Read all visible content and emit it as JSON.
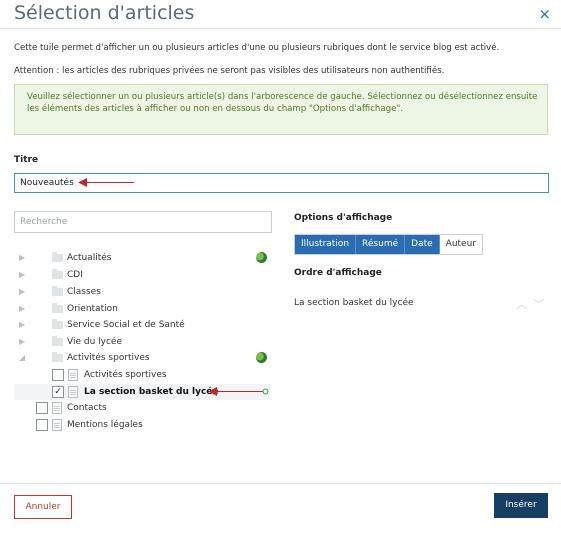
{
  "dialog": {
    "title": "Sélection d'articles",
    "close_label": "×",
    "intro_line_1": "Cette tuile permet d'afficher un ou plusieurs articles d'une ou plusieurs rubriques dont le service blog est activé.",
    "intro_line_2": "Attention : les articles des rubriques privées ne seront pas visibles des utilisateurs non authentifiés.",
    "info_line_1": "Veuillez sélectionner un ou plusieurs article(s) dans l'arborescence de gauche. Sélectionnez ou désélectionnez ensuite",
    "info_line_2": "les éléments des articles à afficher ou non en dessous du champ \"Options d'affichage\"."
  },
  "form": {
    "titre_label": "Titre",
    "titre_value": "Nouveautés"
  },
  "tree": {
    "search_placeholder": "Recherche",
    "items": [
      {
        "label": "Actualités"
      },
      {
        "label": "CDI"
      },
      {
        "label": "Classes"
      },
      {
        "label": "Orientation"
      },
      {
        "label": "Service Social et de Santé"
      },
      {
        "label": "Vie du lycée"
      },
      {
        "label": "Activités sportives"
      },
      {
        "label": "Activités sportives"
      },
      {
        "label": "La section basket du lycée",
        "checked": true
      },
      {
        "label": "Contacts"
      },
      {
        "label": "Mentions légales"
      }
    ]
  },
  "options": {
    "title": "Options d'affichage",
    "buttons": [
      "Illustration",
      "Résumé",
      "Date",
      "Auteur"
    ],
    "order_title": "Ordre d'affichage",
    "order_item": "La section basket du lycée"
  },
  "footer": {
    "cancel_label": "Annuler",
    "insert_label": "Insérer"
  },
  "colors": {
    "accent": "#2a6db3",
    "insert_button": "#173f63",
    "cancel_border": "#c0392b",
    "info_bg": "#eef6e6",
    "info_text": "#4d7a27"
  }
}
